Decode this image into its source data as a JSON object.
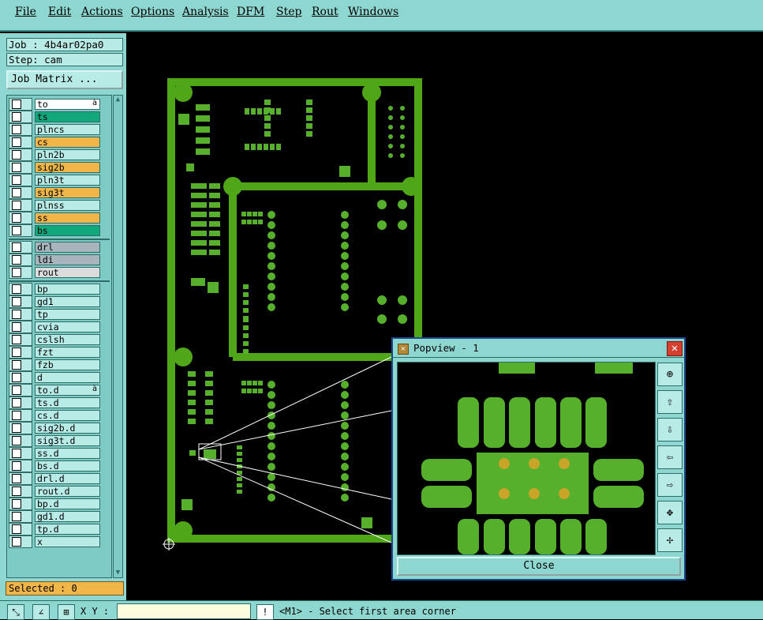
{
  "menu": [
    "File",
    "Edit",
    "Actions",
    "Options",
    "Analysis",
    "DFM",
    "Step",
    "Rout",
    "Windows"
  ],
  "job": "Job : 4b4ar02pa0",
  "step": "Step: cam",
  "job_matrix_label": "Job Matrix ...",
  "layers": [
    {
      "name": "to",
      "color": "#ffffff",
      "mark": "à"
    },
    {
      "name": "ts",
      "color": "#12a87c",
      "mark": ""
    },
    {
      "name": "plncs",
      "color": "#b9ebe6",
      "mark": ""
    },
    {
      "name": "cs",
      "color": "#f0b649",
      "mark": ""
    },
    {
      "name": "pln2b",
      "color": "#b9ebe6",
      "mark": ""
    },
    {
      "name": "sig2b",
      "color": "#f0b649",
      "mark": ""
    },
    {
      "name": "pln3t",
      "color": "#b9ebe6",
      "mark": ""
    },
    {
      "name": "sig3t",
      "color": "#f0b649",
      "mark": ""
    },
    {
      "name": "plnss",
      "color": "#b9ebe6",
      "mark": ""
    },
    {
      "name": "ss",
      "color": "#f0b649",
      "mark": ""
    },
    {
      "name": "bs",
      "color": "#12a87c",
      "mark": ""
    },
    {
      "name": "drl",
      "color": "#a9b5bc",
      "mark": ""
    },
    {
      "name": "ldi",
      "color": "#a9b5bc",
      "mark": ""
    },
    {
      "name": "rout",
      "color": "#dcdcdc",
      "mark": ""
    },
    {
      "name": "bp",
      "color": "#b9ebe6",
      "mark": ""
    },
    {
      "name": "gd1",
      "color": "#b9ebe6",
      "mark": ""
    },
    {
      "name": "tp",
      "color": "#b9ebe6",
      "mark": ""
    },
    {
      "name": "cvia",
      "color": "#b9ebe6",
      "mark": ""
    },
    {
      "name": "cslsh",
      "color": "#b9ebe6",
      "mark": ""
    },
    {
      "name": "fzt",
      "color": "#b9ebe6",
      "mark": ""
    },
    {
      "name": "fzb",
      "color": "#b9ebe6",
      "mark": ""
    },
    {
      "name": "d",
      "color": "#b9ebe6",
      "mark": ""
    },
    {
      "name": "to.d",
      "color": "#b9ebe6",
      "mark": "à"
    },
    {
      "name": "ts.d",
      "color": "#b9ebe6",
      "mark": ""
    },
    {
      "name": "cs.d",
      "color": "#b9ebe6",
      "mark": ""
    },
    {
      "name": "sig2b.d",
      "color": "#b9ebe6",
      "mark": ""
    },
    {
      "name": "sig3t.d",
      "color": "#b9ebe6",
      "mark": ""
    },
    {
      "name": "ss.d",
      "color": "#b9ebe6",
      "mark": ""
    },
    {
      "name": "bs.d",
      "color": "#b9ebe6",
      "mark": ""
    },
    {
      "name": "drl.d",
      "color": "#b9ebe6",
      "mark": ""
    },
    {
      "name": "rout.d",
      "color": "#b9ebe6",
      "mark": ""
    },
    {
      "name": "bp.d",
      "color": "#b9ebe6",
      "mark": ""
    },
    {
      "name": "gd1.d",
      "color": "#b9ebe6",
      "mark": ""
    },
    {
      "name": "tp.d",
      "color": "#b9ebe6",
      "mark": ""
    },
    {
      "name": "x",
      "color": "#b9ebe6",
      "mark": ""
    }
  ],
  "selected": "Selected : 0",
  "coord_label": "X Y :",
  "coord_value": "",
  "status": "<M1> - Select first area corner",
  "popview": {
    "title": "Popview - 1",
    "close_label": "Close",
    "close_x": "✕"
  },
  "colors": {
    "board": "#4fa617",
    "pad": "#57b02b",
    "drill": "#c8a428",
    "panel": "#8ed6d0"
  }
}
